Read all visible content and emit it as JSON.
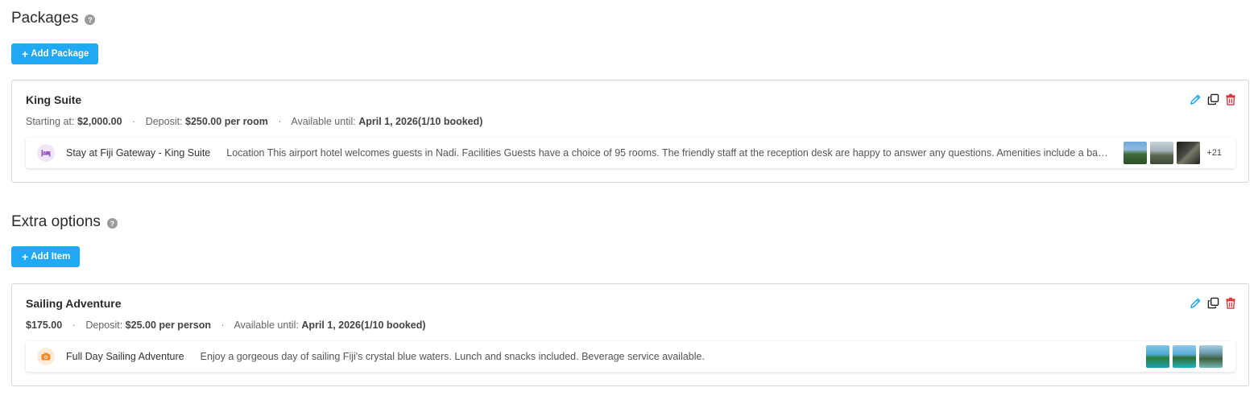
{
  "packages": {
    "title": "Packages",
    "help": "?",
    "add_button": "Add Package",
    "plus": "+",
    "cards": [
      {
        "title": "King Suite",
        "meta": {
          "label1": "Starting at:",
          "value1": "$2,000.00",
          "sep": "·",
          "label2": "Deposit:",
          "value2": "$250.00 per room",
          "label3": "Available until:",
          "value3": "April 1, 2026(1/10 booked)"
        },
        "item": {
          "icon": "bed-icon",
          "name": "Stay at Fiji Gateway - King Suite",
          "description": "Location This airport hotel welcomes guests in Nadi. Facilities Guests have a choice of 95 rooms. The friendly staff at the reception desk are happy to answer any questions. Amenities include a baggage storage service and a tour desk.",
          "more_photos": "+21"
        }
      }
    ]
  },
  "extras": {
    "title": "Extra options",
    "help": "?",
    "add_button": "Add Item",
    "plus": "+",
    "cards": [
      {
        "title": "Sailing Adventure",
        "meta": {
          "value1": "$175.00",
          "sep": "·",
          "label2": "Deposit:",
          "value2": "$25.00 per person",
          "label3": "Available until:",
          "value3": "April 1, 2026(1/10 booked)"
        },
        "item": {
          "icon": "camera-icon",
          "name": "Full Day Sailing Adventure",
          "description": "Enjoy a gorgeous day of sailing Fiji's crystal blue waters. Lunch and snacks included. Beverage service available."
        }
      }
    ]
  },
  "colors": {
    "accent": "#1fa8f3",
    "delete": "#d9363e",
    "bed_icon_bg": "#efe6f7",
    "bed_icon": "#9b59c8",
    "camera_icon_bg": "#fdebd9",
    "camera_icon": "#f08a2c"
  }
}
